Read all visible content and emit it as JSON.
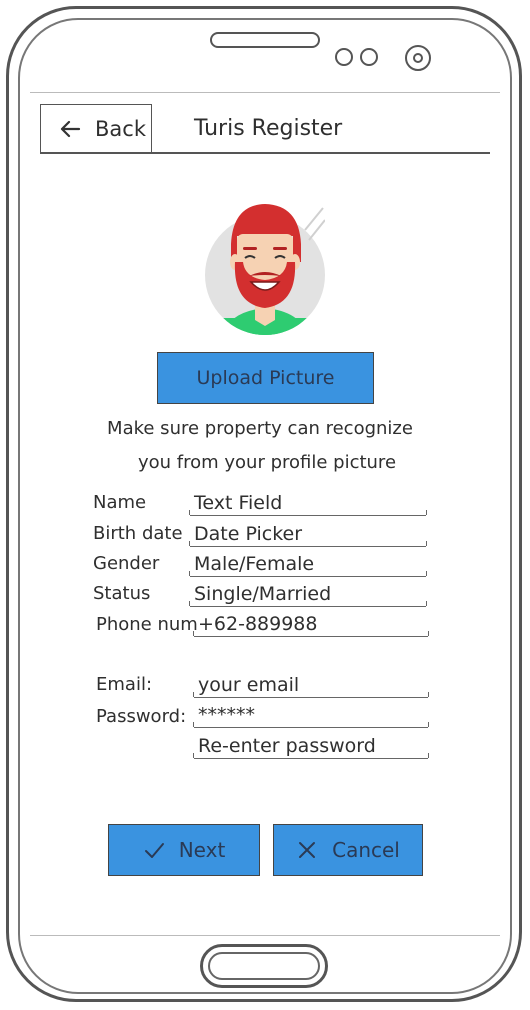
{
  "header": {
    "back_label": "Back",
    "title": "Turis Register"
  },
  "profile": {
    "upload_label": "Upload Picture",
    "hint_line_1": "Make sure property can recognize",
    "hint_line_2": "you from your profile picture"
  },
  "form": {
    "name": {
      "label": "Name",
      "value": "Text Field"
    },
    "birth_date": {
      "label": "Birth date",
      "value": "Date Picker"
    },
    "gender": {
      "label": "Gender",
      "value": "Male/Female"
    },
    "status": {
      "label": "Status",
      "value": "Single/Married"
    },
    "phone": {
      "label": "Phone num",
      "value": "+62-889988"
    },
    "email": {
      "label": "Email:",
      "value": "your email"
    },
    "password": {
      "label": "Password:",
      "value": "******"
    },
    "password_confirm": {
      "value": "Re-enter password"
    }
  },
  "actions": {
    "next_label": "Next",
    "cancel_label": "Cancel"
  },
  "colors": {
    "button_blue": "#3a93e0",
    "avatar_hair": "#d32f2f",
    "avatar_shirt": "#2ecc71"
  },
  "icons": {
    "back": "arrow-left-icon",
    "next": "check-icon",
    "cancel": "x-icon",
    "avatar": "avatar-icon"
  }
}
